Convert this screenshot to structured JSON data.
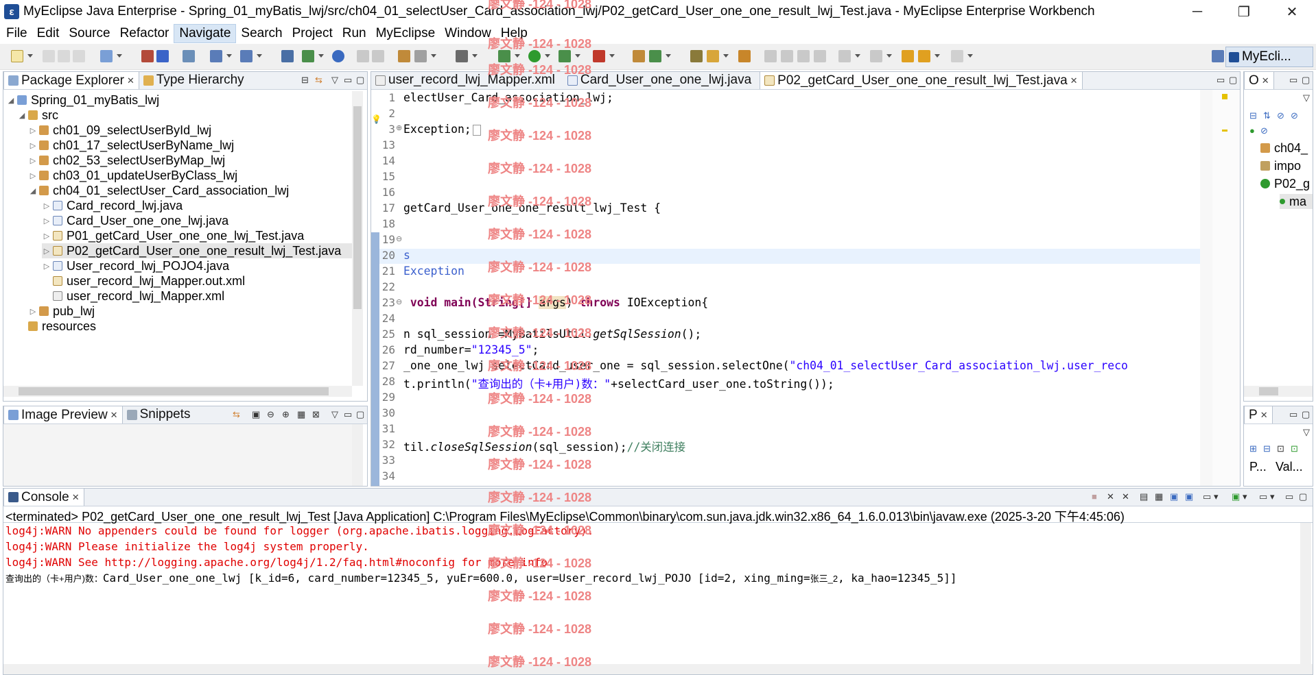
{
  "window": {
    "title": "MyEclipse Java Enterprise - Spring_01_myBatis_lwj/src/ch04_01_selectUser_Card_association_lwj/P02_getCard_User_one_one_result_lwj_Test.java - MyEclipse Enterprise Workbench",
    "minimize": "─",
    "maximize": "❐",
    "close": "✕"
  },
  "menu": [
    "File",
    "Edit",
    "Source",
    "Refactor",
    "Navigate",
    "Search",
    "Project",
    "Run",
    "MyEclipse",
    "Window",
    "Help"
  ],
  "perspective": {
    "label": "MyEcli..."
  },
  "package_explorer": {
    "tabs": [
      "Package Explorer",
      "Type Hierarchy"
    ],
    "tree": [
      {
        "label": "Spring_01_myBatis_lwj"
      },
      {
        "label": "src"
      },
      {
        "label": "ch01_09_selectUserById_lwj"
      },
      {
        "label": "ch01_17_selectUserByName_lwj"
      },
      {
        "label": "ch02_53_selectUserByMap_lwj"
      },
      {
        "label": "ch03_01_updateUserByClass_lwj"
      },
      {
        "label": "ch04_01_selectUser_Card_association_lwj"
      },
      {
        "label": "Card_record_lwj.java"
      },
      {
        "label": "Card_User_one_one_lwj.java"
      },
      {
        "label": "P01_getCard_User_one_one_lwj_Test.java"
      },
      {
        "label": "P02_getCard_User_one_one_result_lwj_Test.java"
      },
      {
        "label": "User_record_lwj_POJO4.java"
      },
      {
        "label": "user_record_lwj_Mapper.out.xml"
      },
      {
        "label": "user_record_lwj_Mapper.xml"
      },
      {
        "label": "pub_lwj"
      },
      {
        "label": "resources"
      }
    ]
  },
  "image_preview": {
    "tabs": [
      "Image Preview",
      "Snippets"
    ]
  },
  "editor": {
    "tabs": [
      "user_record_lwj_Mapper.xml",
      "Card_User_one_one_lwj.java",
      "P02_getCard_User_one_one_result_lwj_Test.java"
    ],
    "lines": {
      "n1": "1",
      "n2": "2",
      "n3": "3",
      "n13": "13",
      "n14": "14",
      "n15": "15",
      "n16": "16",
      "n17": "17",
      "n18": "18",
      "n19": "19",
      "n20": "20",
      "n21": "21",
      "n22": "22",
      "n23": "23",
      "n24": "24",
      "n25": "25",
      "n26": "26",
      "n27": "27",
      "n28": "28",
      "n29": "29",
      "n30": "30",
      "n31": "31",
      "n32": "32",
      "n33": "33",
      "n34": "34",
      "c1": "electUser_Card_association_lwj;",
      "c3": "Exception;",
      "c17": "getCard_User_one_one_result_lwj_Test {",
      "c20": "s",
      "c21": "Exception",
      "c23a": " void main(String[] ",
      "c23b": "args",
      "c23c": ") ",
      "c23d": "throws",
      "c23e": " IOException{",
      "c25a": "n sql_session =MyBatilsUtil.",
      "c25b": "getSqlSession",
      "c25c": "();",
      "c26a": "rd_number=",
      "c26b": "\"12345_5\"",
      "c26c": ";",
      "c27a": "_one_one_lwj selectCard_user_one = sql_session.selectOne(",
      "c27b": "\"ch04_01_selectUser_Card_association_lwj.user_reco",
      "c28a": "t.println(",
      "c28b": "\"查询出的（卡+用户)数：\"",
      "c28c": "+selectCard_user_one.toString());",
      "c32a": "til.",
      "c32b": "closeSqlSession",
      "c32c": "(sql_session);",
      "c32d": "//关闭连接"
    }
  },
  "outline": {
    "tab": "O",
    "items": [
      "ch04_",
      "impo",
      "P02_g",
      "ma"
    ]
  },
  "properties": {
    "tab": "P",
    "cols": [
      "P...",
      "Val..."
    ]
  },
  "console": {
    "tab": "Console",
    "header": "<terminated> P02_getCard_User_one_one_result_lwj_Test [Java Application] C:\\Program Files\\MyEclipse\\Common\\binary\\com.sun.java.jdk.win32.x86_64_1.6.0.013\\bin\\javaw.exe (2025-3-20 下午4:45:06)",
    "warn1": "log4j:WARN No appenders could be found for logger (org.apache.ibatis.logging.LogFactory).",
    "warn2": "log4j:WARN Please initialize the log4j system properly.",
    "warn3": "log4j:WARN See http://logging.apache.org/log4j/1.2/faq.html#noconfig for more info.",
    "out_prefix": "查询出的（卡+用户)数：",
    "out_a": "Card_User_one_one_lwj [k_id=6, card_number=12345_5, yuEr=600.0, user=User_record_lwj_POJO [id=2, xing_ming=",
    "out_name": "张三_2",
    "out_b": ", ka_hao=12345_5]]"
  },
  "watermark": {
    "text": "廖文静 -124 - 1028"
  },
  "colors": {
    "accent": "#3a5fcd",
    "warn": "#e00000",
    "keyword": "#7f0055",
    "string": "#2a00ff",
    "comment": "#3f7f5f",
    "watermark": "#ee8484"
  }
}
